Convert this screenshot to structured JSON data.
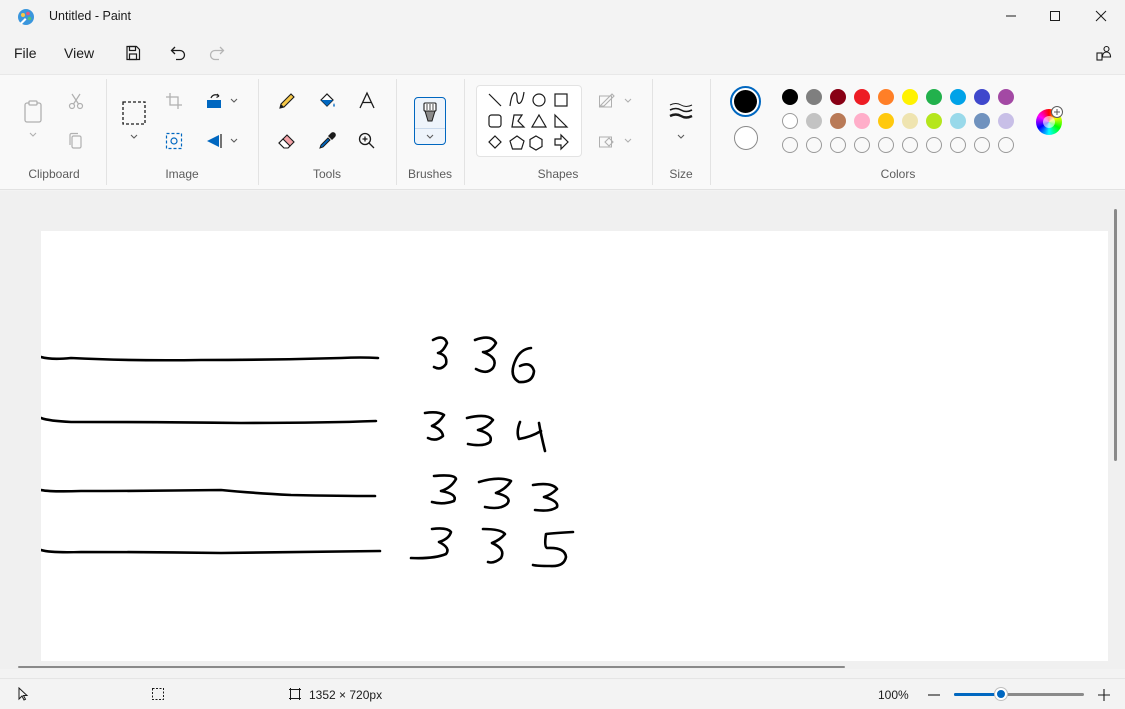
{
  "window": {
    "title": "Untitled - Paint"
  },
  "menu": {
    "file": "File",
    "view": "View"
  },
  "ribbon": {
    "groups": {
      "clipboard": "Clipboard",
      "image": "Image",
      "tools": "Tools",
      "brushes": "Brushes",
      "shapes": "Shapes",
      "size": "Size",
      "colors": "Colors"
    },
    "tools_icons": [
      "pencil-icon",
      "fill-icon",
      "text-icon",
      "eraser-icon",
      "color-picker-icon",
      "magnifier-icon"
    ],
    "shapes_icons": [
      "line-shape",
      "curve-shape",
      "oval-shape",
      "rectangle-shape",
      "rounded-rectangle-shape",
      "polygon-shape",
      "triangle-shape",
      "right-triangle-shape",
      "diamond-shape",
      "pentagon-shape",
      "hexagon-shape",
      "right-arrow-shape"
    ]
  },
  "colors": {
    "primary": "#000000",
    "secondary": "#ffffff",
    "palette_row1": [
      "#000000",
      "#7f7f7f",
      "#880015",
      "#ed1c24",
      "#ff7f27",
      "#fff200",
      "#22b14c",
      "#00a2e8",
      "#3f48cc",
      "#a349a4"
    ],
    "palette_row2": [
      "#ffffff",
      "#c3c3c3",
      "#b97a57",
      "#ffaec9",
      "#ffc90e",
      "#efe4b0",
      "#b5e61d",
      "#99d9ea",
      "#7092be",
      "#c8bfe7"
    ],
    "palette_row3_empty_count": 10
  },
  "canvas": {
    "handwritten_numbers": [
      "336",
      "334",
      "333",
      "335"
    ]
  },
  "status": {
    "canvas_size": "1352 × 720px",
    "zoom": "100%",
    "zoom_fraction": 0.35
  }
}
